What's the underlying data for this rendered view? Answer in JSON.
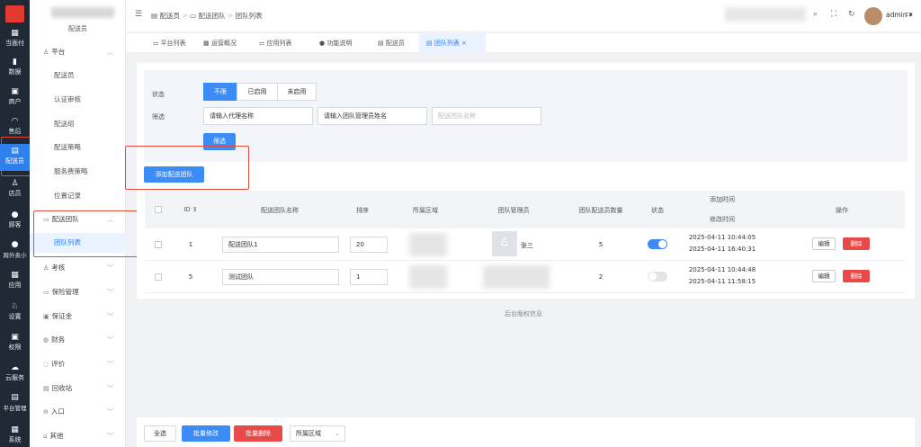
{
  "rail": {
    "items": [
      {
        "label": "当面付",
        "icon": "qr-icon"
      },
      {
        "label": "数据",
        "icon": "chart-icon"
      },
      {
        "label": "商户",
        "icon": "store-icon"
      },
      {
        "label": "售后",
        "icon": "headset-icon"
      },
      {
        "label": "配送员",
        "icon": "courier-icon",
        "active": true
      },
      {
        "label": "店员",
        "icon": "user-icon"
      },
      {
        "label": "顾客",
        "icon": "customer-icon"
      },
      {
        "label": "跨外卖小",
        "icon": "chat-icon"
      },
      {
        "label": "应用",
        "icon": "grid-icon"
      },
      {
        "label": "设置",
        "icon": "gear-icon"
      },
      {
        "label": "权限",
        "icon": "lock-icon"
      },
      {
        "label": "云服务",
        "icon": "cloud-icon"
      },
      {
        "label": "平台管理",
        "icon": "doc-icon"
      },
      {
        "label": "系统",
        "icon": "system-icon"
      }
    ]
  },
  "submenu": {
    "title": "配送员",
    "platform": "平台",
    "items": [
      "配送员",
      "认证审核",
      "配送组",
      "配送策略",
      "服务费策略",
      "位置记录"
    ],
    "team_group": "配送团队",
    "team_list": "团队列表",
    "groups": [
      "考核",
      "保险管理",
      "保证金",
      "财务",
      "评价",
      "回收站",
      "入口",
      "其他"
    ]
  },
  "topbar": {
    "breadcrumb": [
      "配送员",
      "配送团队",
      "团队列表"
    ],
    "user": "admin"
  },
  "tabs": [
    "平台列表",
    "运营概况",
    "应用列表",
    "功能说明",
    "配送员",
    "团队列表"
  ],
  "filter": {
    "status_label": "状态",
    "status_options": [
      "不限",
      "已启用",
      "未启用"
    ],
    "filter_label": "筛选",
    "agent_input": "请输入代理名称",
    "manager_input": "请输入团队管理员姓名",
    "team_placeholder": "配送团队名称",
    "filter_button": "筛选"
  },
  "add_button": "添加配送团队",
  "table": {
    "headers": {
      "id": "ID",
      "name": "配送团队名称",
      "sort": "排序",
      "region": "所属区域",
      "manager": "团队管理员",
      "count": "团队配送员数量",
      "status": "状态",
      "add_time": "添加时间",
      "mod_time": "修改时间",
      "ops": "操作"
    },
    "rows": [
      {
        "id": "1",
        "name": "配送团队1",
        "sort": "20",
        "manager": "张三",
        "count": "5",
        "status_on": true,
        "add_time": "2025-04-11 10:44:05",
        "mod_time": "2025-04-11 16:40:31",
        "edit": "编辑",
        "delete": "删除"
      },
      {
        "id": "5",
        "name": "测试团队",
        "sort": "1",
        "manager": "",
        "count": "2",
        "status_on": false,
        "add_time": "2025-04-11 10:44:48",
        "mod_time": "2025-04-11 11:58:15",
        "edit": "编辑",
        "delete": "删除"
      }
    ]
  },
  "footer": "后台版权信息",
  "bottom_bar": {
    "select_all": "全选",
    "batch_edit": "批量修改",
    "batch_delete": "批量删除",
    "region_select": "所属区域"
  },
  "colors": {
    "accent": "#3b8cf7",
    "danger": "#e84a4a",
    "rail_bg": "#202a36",
    "highlight": "#e24a3b"
  }
}
